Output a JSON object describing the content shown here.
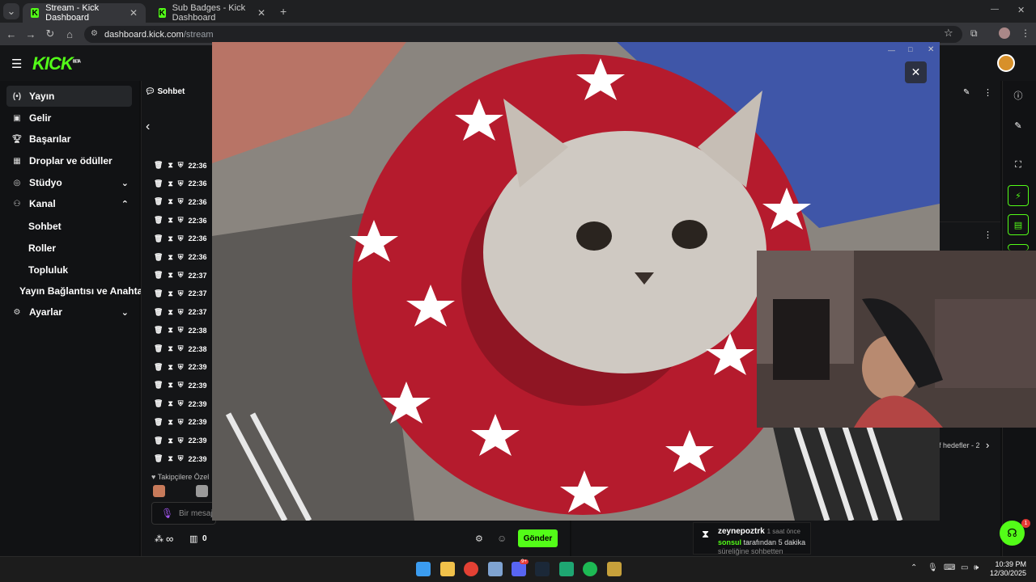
{
  "browser": {
    "tabs": [
      {
        "label": "Stream - Kick Dashboard",
        "active": true
      },
      {
        "label": "Sub Badges - Kick Dashboard",
        "active": false
      }
    ],
    "url_host": "dashboard.kick.com",
    "url_path": "/stream"
  },
  "app": {
    "logo": "KICK",
    "logo_badge": "BETA"
  },
  "sidebar": {
    "items": [
      {
        "label": "Yayın",
        "icon": "broadcast-icon"
      },
      {
        "label": "Gelir",
        "icon": "revenue-icon"
      },
      {
        "label": "Başarılar",
        "icon": "trophy-icon"
      },
      {
        "label": "Droplar ve ödüller",
        "icon": "gift-icon"
      },
      {
        "label": "Stüdyo",
        "icon": "studio-icon"
      },
      {
        "label": "Kanal",
        "icon": "channel-icon"
      }
    ],
    "channel_sub": [
      "Sohbet",
      "Roller",
      "Topluluk",
      "Yayın Bağlantısı ve Anahtarı"
    ],
    "settings": "Ayarlar"
  },
  "chat": {
    "title": "Sohbet",
    "times": [
      "22:36",
      "22:36",
      "22:36",
      "22:36",
      "22:36",
      "22:36",
      "22:37",
      "22:37",
      "22:37",
      "22:38",
      "22:38",
      "22:39",
      "22:39",
      "22:39",
      "22:39",
      "22:39",
      "22:39"
    ],
    "followers_label": "Takipçilere Özel",
    "input_placeholder": "Bir mesaj",
    "send_label": "Gönder",
    "viewer_count": "0",
    "infinity": "∞"
  },
  "goals": {
    "text": "f hedefler - 2"
  },
  "notification": {
    "user": "zeynepoztrk",
    "time": "1 saat önce",
    "actor": "sonsul",
    "message": "tarafından 5 dakika",
    "message2": "süreliğine sohbetten"
  },
  "taskbar": {
    "time": "10:39 PM",
    "date": "12/30/2025",
    "discord_badge": "9+",
    "support_badge": "1"
  }
}
